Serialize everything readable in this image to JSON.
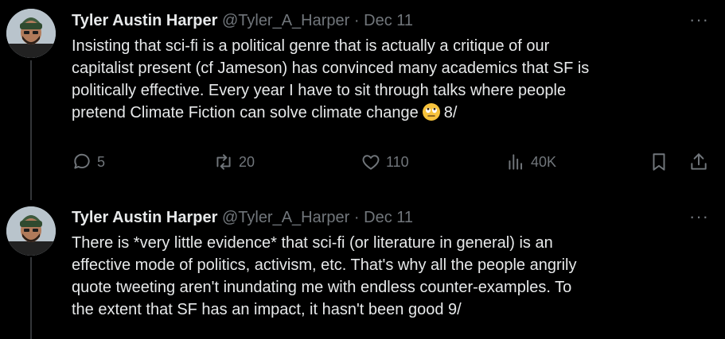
{
  "tweets": [
    {
      "name": "Tyler Austin Harper",
      "handle": "@Tyler_A_Harper",
      "separator": "·",
      "date": "Dec 11",
      "more": "···",
      "text_before_emoji": "Insisting that sci-fi is a political genre that is actually a critique of our\ncapitalist present (cf Jameson) has convinced many academics that SF is\npolitically effective. Every year I have to sit through talks where people\npretend Climate Fiction can solve climate change",
      "emoji": "face-with-rolling-eyes",
      "text_after_emoji": "8/",
      "actions": {
        "reply_count": "5",
        "retweet_count": "20",
        "like_count": "110",
        "views_count": "40K"
      }
    },
    {
      "name": "Tyler Austin Harper",
      "handle": "@Tyler_A_Harper",
      "separator": "·",
      "date": "Dec 11",
      "more": "···",
      "text": "There is *very little evidence* that sci-fi (or literature in general) is an\neffective mode of politics, activism, etc. That's why all the people angrily\nquote tweeting aren't inundating me with endless counter-examples. To\nthe extent that SF has an impact, it hasn't been good 9/"
    }
  ],
  "colors": {
    "background": "#000000",
    "text": "#e7e9ea",
    "muted": "#71767b",
    "thread_line": "#333639"
  },
  "icons": [
    "reply-icon",
    "retweet-icon",
    "like-icon",
    "views-icon",
    "bookmark-icon",
    "share-icon"
  ]
}
